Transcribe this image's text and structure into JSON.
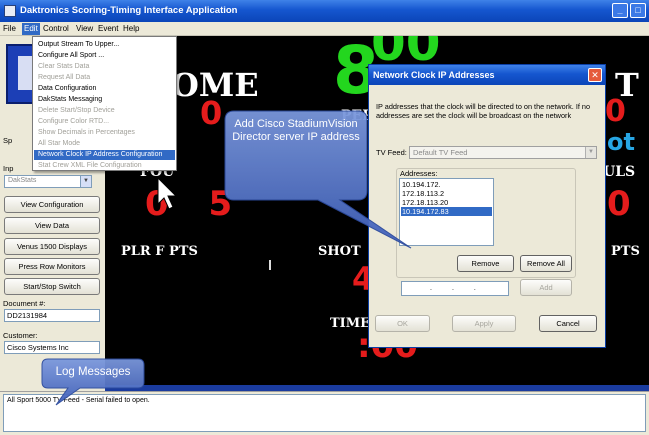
{
  "window": {
    "title": "Daktronics Scoring-Timing Interface Application",
    "min_glyph": "_",
    "max_glyph": "□"
  },
  "menu": [
    "File",
    "Edit",
    "Control",
    "View",
    "Event",
    "Help"
  ],
  "edit_menu": [
    {
      "label": "Output Stream To Upper...",
      "enabled": true
    },
    {
      "label": "Configure All Sport ...",
      "enabled": true
    },
    {
      "label": "Clear Stats Data",
      "enabled": false
    },
    {
      "label": "Request All Data",
      "enabled": false
    },
    {
      "label": "Data Configuration",
      "enabled": true
    },
    {
      "label": "DakStats Messaging",
      "enabled": true
    },
    {
      "label": "Delete Start/Stop Device",
      "enabled": false
    },
    {
      "label": "Configure Color RTD...",
      "enabled": false
    },
    {
      "label": "Show Decimals in Percentages",
      "enabled": false
    },
    {
      "label": "All Star Mode",
      "enabled": false
    },
    {
      "label": "Network Clock IP Address Configuration",
      "enabled": true,
      "selected": true
    },
    {
      "label": "Stat Crew XML File Configuration",
      "enabled": false
    }
  ],
  "left_panel": {
    "sp_label": "Sp",
    "inp_label": "Inp",
    "source_value": "DakStats",
    "buttons": [
      "View Configuration",
      "View Data",
      "Venus 1500 Displays",
      "Press Row Monitors",
      "Start/Stop Switch"
    ],
    "document_label": "Document #:",
    "document_value": "DD2131984",
    "customer_label": "Customer:",
    "customer_value": "Cisco Systems Inc"
  },
  "scoreboard": {
    "home": "OME",
    "guest_fragment": "T",
    "clock_digit": "8",
    "clock_digits_partial": "00",
    "per_label": "PER",
    "fouls_left": "FOU",
    "fouls_right": "ULS",
    "home_fouls": "0 5",
    "right_digit": "0",
    "right_blue": "ot",
    "right_top_digit": "0",
    "plr_f_pts_left": "PLR F PTS",
    "shot": "SHOT",
    "pts_right": "PTS",
    "shot_digit": "4",
    "time_label": "TIME",
    "time_value": ":00",
    "center_red": "0"
  },
  "dialog": {
    "title": "Network Clock IP Addresses",
    "close_glyph": "✕",
    "description": "IP addresses that the clock will be directed to on the network. If no addresses are set the clock will be broadcast on the network",
    "tv_feed_label": "TV Feed:",
    "tv_feed_value": "Default TV Feed",
    "addresses_label": "Addresses:",
    "addresses": [
      "10.194.172.",
      "172.18.113.2",
      "172.18.113.20",
      "10.194.172.83"
    ],
    "selected_index": 3,
    "remove_label": "Remove",
    "remove_all_label": "Remove All",
    "add_label": "Add",
    "ip_dots": "...",
    "ok_label": "OK",
    "apply_label": "Apply",
    "cancel_label": "Cancel"
  },
  "callouts": {
    "add_cisco": "Add Cisco StadiumVision Director server IP address",
    "log_messages": "Log Messages"
  },
  "status": {
    "message": "All Sport 5000 TV Feed - Serial failed to open."
  },
  "colors": {
    "scoreboard_bg": "#000000",
    "score_red": "#e51c1c",
    "clock_green": "#23d61e",
    "callout_blue": "#5473c4",
    "title_blue": "#1556cf"
  }
}
